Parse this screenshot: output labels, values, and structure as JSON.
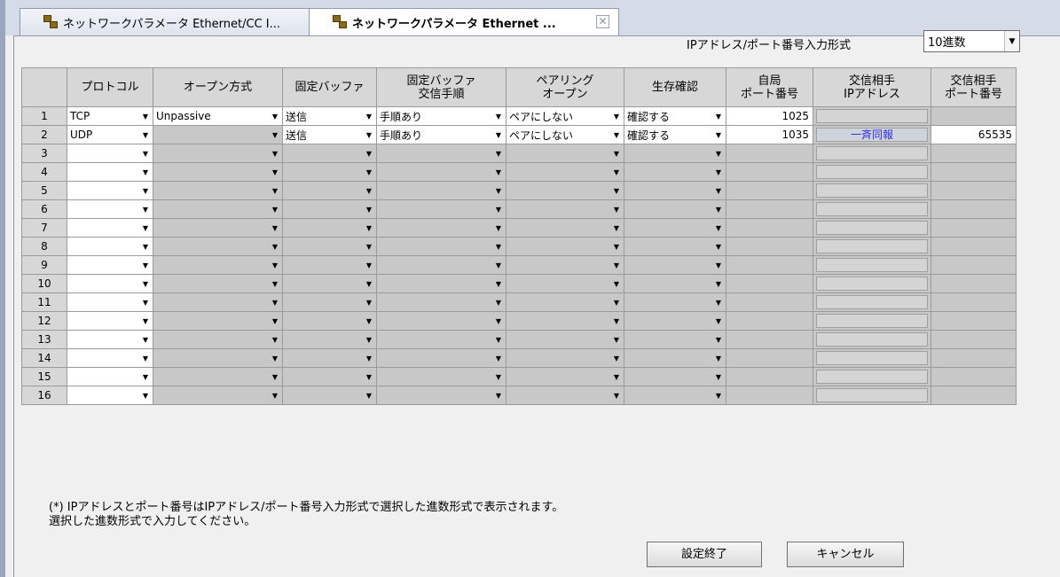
{
  "tabs": [
    {
      "label": "ネットワークパラメータ Ethernet/CC I...",
      "active": false,
      "icon": "network-icon"
    },
    {
      "label": "ネットワークパラメータ Ethernet ...",
      "active": true,
      "icon": "network-icon",
      "close": "✕"
    }
  ],
  "ip_format": {
    "label": "IPアドレス/ポート番号入力形式",
    "value": "10進数"
  },
  "columns": [
    "",
    "プロトコル",
    "オープン方式",
    "固定バッファ",
    "固定バッファ\n交信手順",
    "ペアリング\nオープン",
    "生存確認",
    "自局\nポート番号",
    "交信相手\nIPアドレス",
    "交信相手\nポート番号"
  ],
  "rows": [
    {
      "no": "1",
      "protocol": "TCP",
      "open_method": "Unpassive",
      "fixed_buffer": "送信",
      "buffer_procedure": "手順あり",
      "pairing": "ペアにしない",
      "alive_check": "確認する",
      "own_port": "1025",
      "dest_ip": "",
      "dest_port": ""
    },
    {
      "no": "2",
      "protocol": "UDP",
      "open_method": "",
      "fixed_buffer": "送信",
      "buffer_procedure": "手順あり",
      "pairing": "ペアにしない",
      "alive_check": "確認する",
      "own_port": "1035",
      "dest_ip": "一斉同報",
      "dest_port": "65535"
    },
    {
      "no": "3"
    },
    {
      "no": "4"
    },
    {
      "no": "5"
    },
    {
      "no": "6"
    },
    {
      "no": "7"
    },
    {
      "no": "8"
    },
    {
      "no": "9"
    },
    {
      "no": "10"
    },
    {
      "no": "11"
    },
    {
      "no": "12"
    },
    {
      "no": "13"
    },
    {
      "no": "14"
    },
    {
      "no": "15"
    },
    {
      "no": "16"
    }
  ],
  "note_line1": "(*) IPアドレスとポート番号はIPアドレス/ポート番号入力形式で選択した進数形式で表示されます。",
  "note_line2": "選択した進数形式で入力してください。",
  "buttons": {
    "ok": "設定終了",
    "cancel": "キャンセル"
  },
  "colors": {
    "link": "#2e2ee8",
    "disabled_cell": "#c8c8c8",
    "header": "#d7d7d7"
  }
}
